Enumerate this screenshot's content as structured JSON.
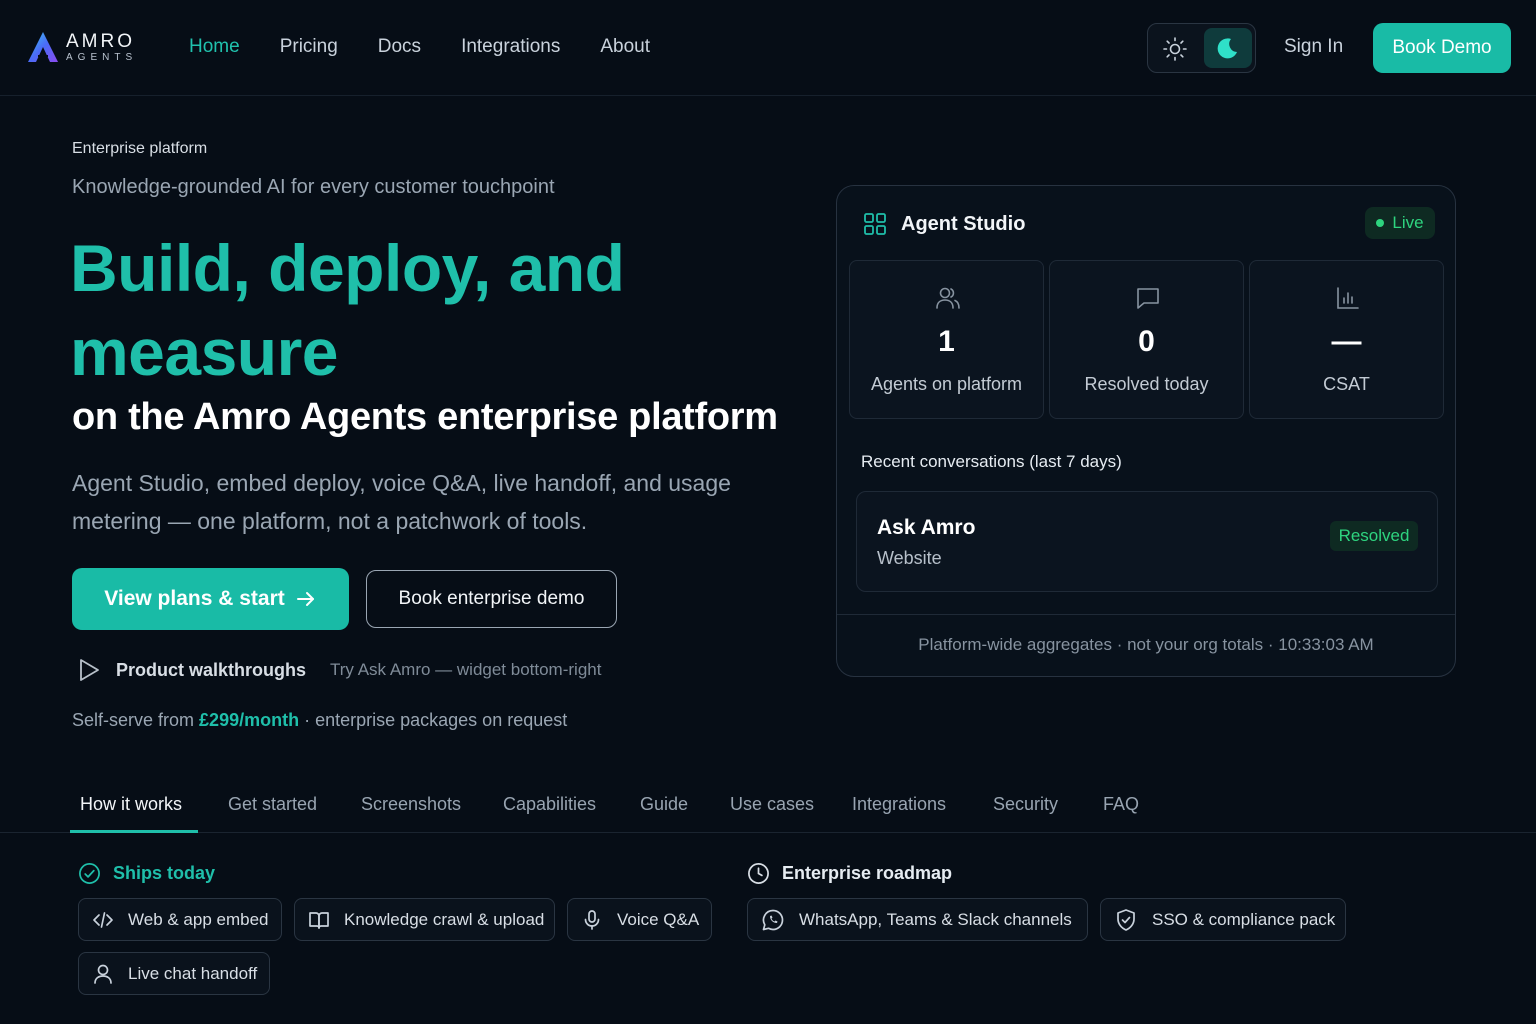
{
  "header": {
    "logo_main": "AMRO",
    "logo_sub": "AGENTS",
    "nav": [
      {
        "label": "Home",
        "active": true
      },
      {
        "label": "Pricing",
        "active": false
      },
      {
        "label": "Docs",
        "active": false
      },
      {
        "label": "Integrations",
        "active": false
      },
      {
        "label": "About",
        "active": false
      }
    ],
    "sign_in": "Sign In",
    "book_demo": "Book Demo",
    "theme_icons": [
      "sun-icon",
      "moon-icon"
    ]
  },
  "hero": {
    "eyebrow": "Enterprise platform",
    "tagline": "Knowledge-grounded AI for every customer touchpoint",
    "title": "Build, deploy, and measure",
    "subtitle": "on the Amro Agents enterprise platform",
    "description": "Agent Studio, embed deploy, voice Q&A, live handoff, and usage metering — one platform, not a patchwork of tools.",
    "primary_cta": "View plans & start",
    "secondary_cta": "Book enterprise demo",
    "walkthrough": "Product walkthroughs",
    "try_hint": "Try Ask Amro — widget bottom-right",
    "pricing_prefix": "Self-serve from",
    "pricing_price": "£299/month",
    "pricing_suffix": "· enterprise packages on request"
  },
  "studio": {
    "title": "Agent Studio",
    "live": "Live",
    "stats": [
      {
        "icon": "users-icon",
        "value": "1",
        "label": "Agents on platform"
      },
      {
        "icon": "chat-icon",
        "value": "0",
        "label": "Resolved today"
      },
      {
        "icon": "bar-chart-icon",
        "value": "—",
        "label": "CSAT"
      }
    ],
    "recent_title": "Recent conversations (last 7 days)",
    "conversation": {
      "name": "Ask Amro",
      "source": "Website",
      "status": "Resolved"
    },
    "footer": "Platform-wide aggregates · not your org totals · 10:33:03 AM"
  },
  "tabs": [
    {
      "label": "How it works",
      "active": true
    },
    {
      "label": "Get started"
    },
    {
      "label": "Screenshots"
    },
    {
      "label": "Capabilities"
    },
    {
      "label": "Guide"
    },
    {
      "label": "Use cases"
    },
    {
      "label": "Integrations"
    },
    {
      "label": "Security"
    },
    {
      "label": "FAQ"
    }
  ],
  "ships_today": {
    "title": "Ships today",
    "items": [
      "Web & app embed",
      "Knowledge crawl & upload",
      "Voice Q&A",
      "Live chat handoff"
    ]
  },
  "roadmap": {
    "title": "Enterprise roadmap",
    "items": [
      "WhatsApp, Teams & Slack channels",
      "SSO & compliance pack"
    ]
  },
  "colors": {
    "accent": "#1fbfaa",
    "background": "#060d16",
    "success": "#2ed47f"
  }
}
